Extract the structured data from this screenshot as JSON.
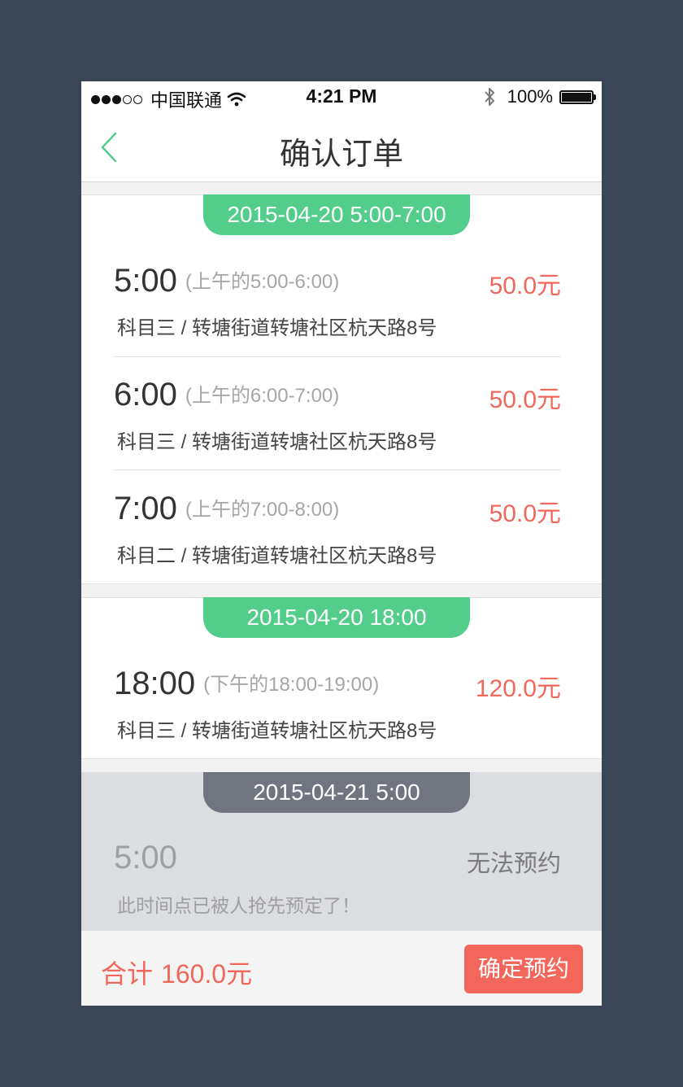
{
  "status_bar": {
    "carrier": "中国联通",
    "time": "4:21 PM",
    "battery": "100%",
    "battery_level": 1.0
  },
  "nav": {
    "title": "确认订单",
    "back_icon": "chevron-left-icon"
  },
  "groups": [
    {
      "date": "2015-04-20 5:00-7:00",
      "slots": [
        {
          "time": "5:00",
          "range": "(上午的5:00-6:00)",
          "price": "50.0元",
          "desc": "科目三 / 转塘街道转塘社区杭天路8号"
        },
        {
          "time": "6:00",
          "range": "(上午的6:00-7:00)",
          "price": "50.0元",
          "desc": "科目三 / 转塘街道转塘社区杭天路8号"
        },
        {
          "time": "7:00",
          "range": "(上午的7:00-8:00)",
          "price": "50.0元",
          "desc": "科目二 / 转塘街道转塘社区杭天路8号"
        }
      ]
    },
    {
      "date": "2015-04-20 18:00",
      "slots": [
        {
          "time": "18:00",
          "range": "(下午的18:00-19:00)",
          "price": "120.0元",
          "desc": "科目三 / 转塘街道转塘社区杭天路8号"
        }
      ]
    }
  ],
  "unavailable": {
    "date": "2015-04-21 5:00",
    "time": "5:00",
    "status": "无法预约",
    "message": "此时间点已被人抢先预定了！"
  },
  "footer": {
    "total_label": "合计",
    "total_amount": "160.0元",
    "confirm_label": "确定预约"
  },
  "colors": {
    "accent_green": "#52cd8a",
    "price_red": "#f0685b",
    "button_red": "#f2665c",
    "disabled_tab": "#707580"
  }
}
